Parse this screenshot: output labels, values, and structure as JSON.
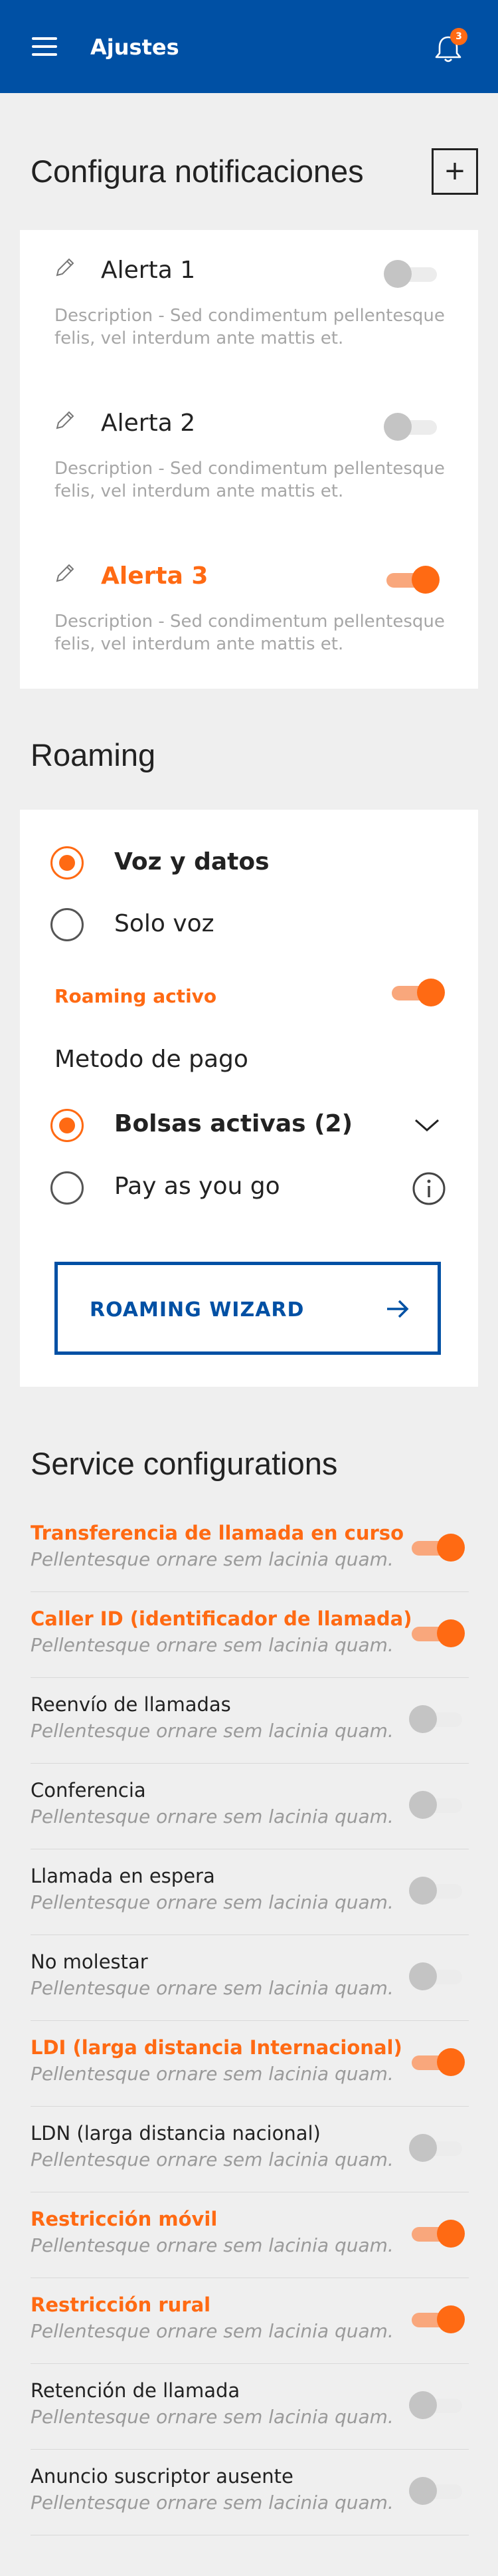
{
  "header": {
    "title": "Ajustes",
    "notification_count": "3"
  },
  "notifications": {
    "title": "Configura notificaciones",
    "add_label": "+",
    "alerts": [
      {
        "name": "Alerta 1",
        "description": "Description - Sed condimentum pellentesque felis, vel interdum ante mattis et.",
        "enabled": false
      },
      {
        "name": "Alerta 2",
        "description": "Description - Sed condimentum pellentesque felis, vel interdum ante mattis et.",
        "enabled": false
      },
      {
        "name": "Alerta 3",
        "description": "Description - Sed condimentum pellentesque felis, vel interdum ante mattis et.",
        "enabled": true
      }
    ]
  },
  "roaming": {
    "title": "Roaming",
    "plans": [
      {
        "label": "Voz y datos",
        "selected": true
      },
      {
        "label": "Solo voz",
        "selected": false
      }
    ],
    "active_label": "Roaming activo",
    "active_enabled": true,
    "payment_title": "Metodo de pago",
    "payment_options": [
      {
        "label": "Bolsas activas (2)",
        "selected": true,
        "icon": "chevron-down-icon"
      },
      {
        "label": "Pay as you go",
        "selected": false,
        "icon": "info-icon"
      }
    ],
    "wizard_label": "ROAMING WIZARD"
  },
  "services": {
    "title": "Service configurations",
    "items": [
      {
        "name": "Transferencia de llamada en curso",
        "description": "Pellentesque ornare sem lacinia quam.",
        "enabled": true
      },
      {
        "name": "Caller ID (identificador de llamada)",
        "description": "Pellentesque ornare sem lacinia quam.",
        "enabled": true
      },
      {
        "name": "Reenvío de llamadas",
        "description": "Pellentesque ornare sem lacinia quam.",
        "enabled": false
      },
      {
        "name": "Conferencia",
        "description": "Pellentesque ornare sem lacinia quam.",
        "enabled": false
      },
      {
        "name": "Llamada en espera",
        "description": "Pellentesque ornare sem lacinia quam.",
        "enabled": false
      },
      {
        "name": "No molestar",
        "description": "Pellentesque ornare sem lacinia quam.",
        "enabled": false
      },
      {
        "name": "LDI (larga distancia Internacional)",
        "description": "Pellentesque ornare sem lacinia quam.",
        "enabled": true
      },
      {
        "name": "LDN (larga distancia nacional)",
        "description": "Pellentesque ornare sem lacinia quam.",
        "enabled": false
      },
      {
        "name": "Restricción móvil",
        "description": "Pellentesque ornare sem lacinia quam.",
        "enabled": true
      },
      {
        "name": "Restricción rural",
        "description": "Pellentesque ornare sem lacinia quam.",
        "enabled": true
      },
      {
        "name": "Retención de llamada",
        "description": "Pellentesque ornare sem lacinia quam.",
        "enabled": false
      },
      {
        "name": "Anuncio suscriptor ausente",
        "description": "Pellentesque ornare sem lacinia quam.",
        "enabled": false
      }
    ]
  },
  "colors": {
    "primary": "#0050a4",
    "accent": "#ff6a13",
    "background": "#efefef"
  }
}
